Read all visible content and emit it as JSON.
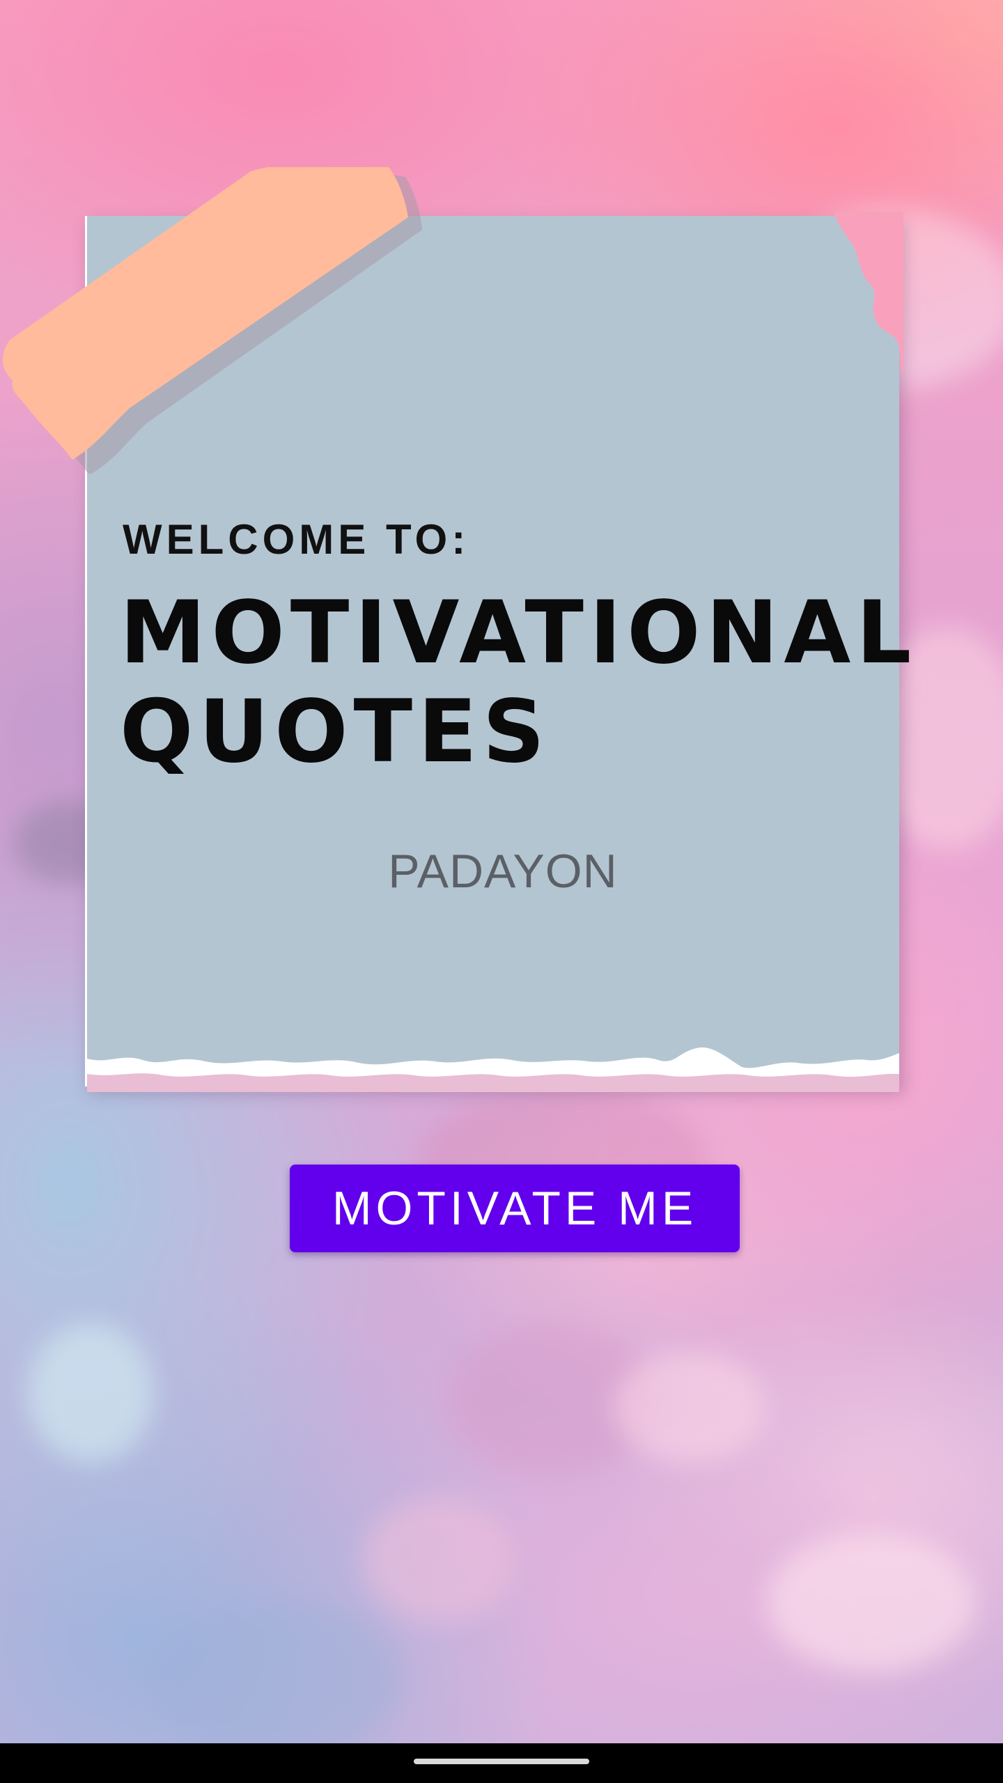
{
  "card": {
    "welcome_label": "WELCOME TO:",
    "title_line1": "MOTIVATIONAL",
    "title_line2": "QUOTES",
    "subtitle": "PADAYON"
  },
  "actions": {
    "motivate_label": "MOTIVATE ME"
  },
  "colors": {
    "paper": "#b4c5d2",
    "tape": "#ffbb9b",
    "button": "#6200ee",
    "button_text": "#ffffff",
    "title_text": "#0a0a0a",
    "subtitle_text": "#5b6066"
  },
  "system": {
    "nav_indicator": "home-gesture-bar"
  }
}
